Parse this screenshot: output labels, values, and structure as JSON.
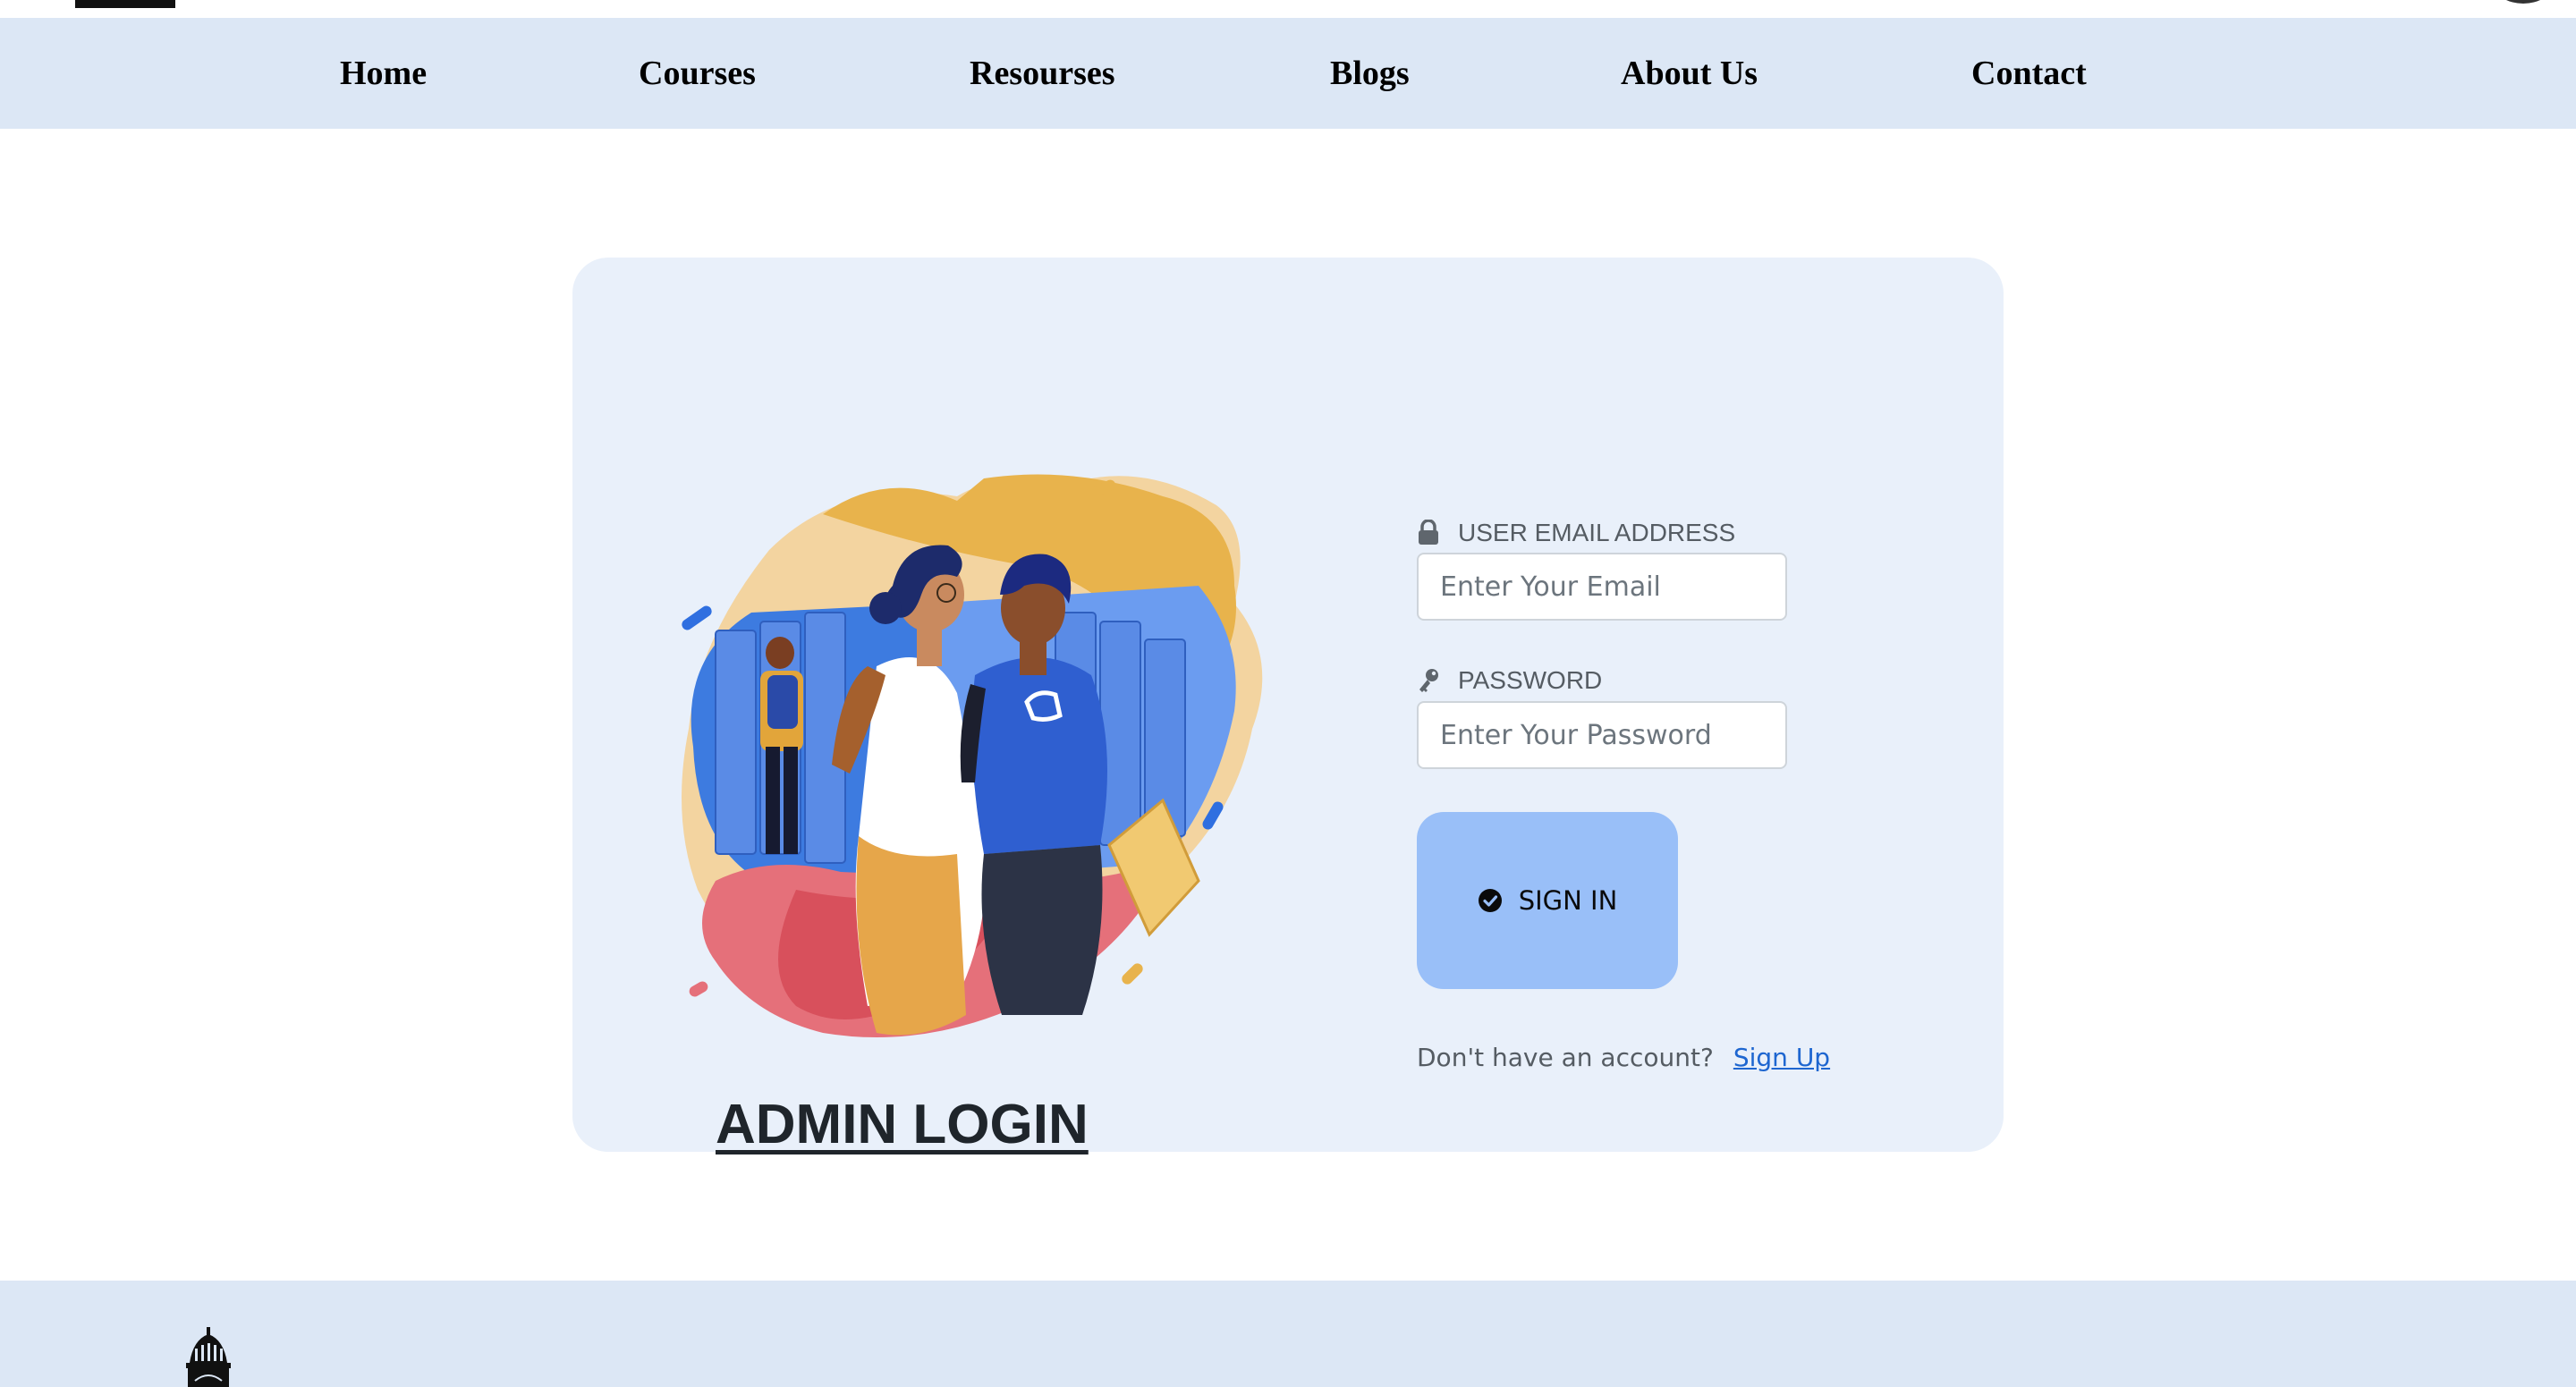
{
  "nav": {
    "items": [
      {
        "label": "Home"
      },
      {
        "label": "Courses"
      },
      {
        "label": "Resourses"
      },
      {
        "label": "Blogs"
      },
      {
        "label": "About Us"
      },
      {
        "label": "Contact"
      }
    ]
  },
  "login": {
    "title": "ADMIN  LOGIN",
    "email": {
      "label": "USER EMAIL ADDRESS",
      "placeholder": "Enter Your Email",
      "icon": "lock-icon"
    },
    "password": {
      "label": "PASSWORD",
      "placeholder": "Enter Your Password",
      "icon": "key-icon"
    },
    "submit": {
      "label": "SIGN IN",
      "icon": "check-circle-icon"
    },
    "signup_prompt": "Don't have an account?",
    "signup_link": "Sign Up"
  },
  "colors": {
    "nav_background": "#dce7f5",
    "card_background": "#e9f0fa",
    "button_background": "#99bff8",
    "link": "#1e66d0",
    "footer_background": "#dce7f5"
  }
}
